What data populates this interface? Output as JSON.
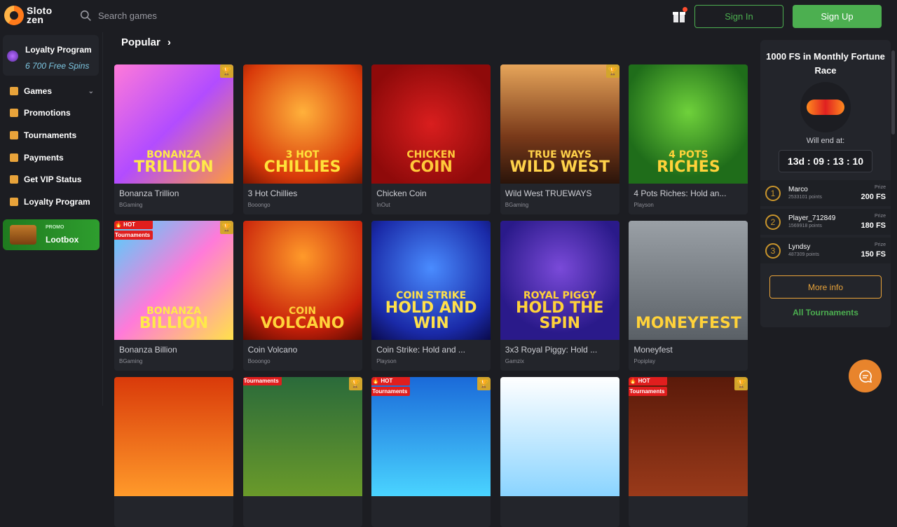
{
  "brand": {
    "name_line1": "Sloto",
    "name_line2": "zen"
  },
  "header": {
    "search_placeholder": "Search games",
    "signin_label": "Sign In",
    "signup_label": "Sign Up",
    "colors": {
      "accent_green": "#4caf50",
      "accent_orange": "#e8a33a",
      "bg": "#1c1d22"
    }
  },
  "sidebar": {
    "loyalty_card": {
      "title": "Loyalty Program",
      "subtitle": "6 700 Free Spins"
    },
    "items": [
      {
        "label": "Games",
        "icon": "gamepad-icon",
        "has_chevron": true
      },
      {
        "label": "Promotions",
        "icon": "gift-icon"
      },
      {
        "label": "Tournaments",
        "icon": "trophy-icon"
      },
      {
        "label": "Payments",
        "icon": "card-icon"
      },
      {
        "label": "Get VIP Status",
        "icon": "star-icon"
      },
      {
        "label": "Loyalty Program",
        "icon": "diamond-icon"
      }
    ],
    "lootbox": {
      "promo": "PROMO",
      "label": "Lootbox"
    }
  },
  "main": {
    "section_title": "Popular",
    "games": [
      {
        "name": "Bonanza Trillion",
        "provider": "BGaming",
        "trophy": true,
        "art_top": "BONANZA",
        "art_bottom": "TRILLION",
        "bg": "linear-gradient(135deg,#ff7ad9,#b24cff 50%,#ff9a3c)",
        "art_color": "#ffe94a"
      },
      {
        "name": "3 Hot Chillies",
        "provider": "Booongo",
        "trophy": false,
        "art_top": "3 HOT",
        "art_bottom": "CHILLIES",
        "bg": "radial-gradient(circle at 50% 40%,#ffb13b,#d93a0a 70%,#7a1400)",
        "art_color": "#ffe23a"
      },
      {
        "name": "Chicken Coin",
        "provider": "InOut",
        "trophy": false,
        "art_top": "CHICKEN",
        "art_bottom": "COIN",
        "bg": "radial-gradient(circle at 50% 50%,#d91e1e,#8f0a0a 80%)",
        "art_color": "#ffc93a"
      },
      {
        "name": "Wild West TRUEWAYS",
        "provider": "BGaming",
        "trophy": true,
        "art_top": "TRUE WAYS",
        "art_bottom": "WILD WEST",
        "bg": "linear-gradient(180deg,#e6a55a,#7a3a1a 60%,#2a140a)",
        "art_color": "#ffd24a"
      },
      {
        "name": "4 Pots Riches: Hold an...",
        "provider": "Playson",
        "trophy": false,
        "art_top": "4 POTS",
        "art_bottom": "RICHES",
        "bg": "radial-gradient(circle at 50% 40%,#6fd13b,#1f6d1a 70%)",
        "art_color": "#ffd23a"
      },
      {
        "name": "Bonanza Billion",
        "provider": "BGaming",
        "trophy": true,
        "badges": [
          "🔥 HOT",
          "Tournaments"
        ],
        "art_top": "BONANZA",
        "art_bottom": "BILLION",
        "bg": "linear-gradient(135deg,#4ad4ff,#ff7ad9 50%,#ffe14a)",
        "art_color": "#ffe94a"
      },
      {
        "name": "Coin Volcano",
        "provider": "Booongo",
        "trophy": false,
        "art_top": "COIN",
        "art_bottom": "VOLCANO",
        "bg": "radial-gradient(circle at 50% 30%,#ff9a2a,#c8200a 70%,#5a0a00)",
        "art_color": "#ffd23a"
      },
      {
        "name": "Coin Strike: Hold and ...",
        "provider": "Playson",
        "trophy": false,
        "art_top": "COIN STRIKE",
        "art_bottom": "HOLD AND WIN",
        "bg": "radial-gradient(circle at 50% 40%,#4a8cff,#1a2aa8 70%,#0a0a4a)",
        "art_color": "#ffe14a"
      },
      {
        "name": "3x3 Royal Piggy: Hold ...",
        "provider": "Gamzix",
        "trophy": false,
        "art_top": "ROYAL PIGGY",
        "art_bottom": "HOLD THE SPIN",
        "bg": "radial-gradient(circle at 50% 40%,#7a4ad9,#2a1a8a 70%)",
        "art_color": "#ffd23a"
      },
      {
        "name": "Moneyfest",
        "provider": "Popiplay",
        "trophy": false,
        "art_top": "",
        "art_bottom": "MONEYFEST",
        "bg": "linear-gradient(180deg,#9aa0a6,#5a6066)",
        "art_color": "#ffd23a"
      },
      {
        "name": "",
        "provider": "",
        "trophy": false,
        "partial": true,
        "bg": "linear-gradient(180deg,#d93a0a,#ff9a2a)"
      },
      {
        "name": "",
        "provider": "",
        "trophy": true,
        "partial": true,
        "badges": [
          "Tournaments"
        ],
        "bg": "linear-gradient(180deg,#2a6a3a,#6a9a2a)"
      },
      {
        "name": "",
        "provider": "",
        "trophy": true,
        "partial": true,
        "badges": [
          "🔥 HOT",
          "Tournaments"
        ],
        "bg": "linear-gradient(180deg,#1a6ad9,#4ad4ff)"
      },
      {
        "name": "",
        "provider": "",
        "trophy": false,
        "partial": true,
        "bg": "linear-gradient(180deg,#ffffff,#8ad4ff)"
      },
      {
        "name": "",
        "provider": "",
        "trophy": true,
        "partial": true,
        "badges": [
          "🔥 HOT",
          "Tournaments"
        ],
        "bg": "linear-gradient(180deg,#5a1a0a,#9a3a1a)"
      }
    ]
  },
  "tournament": {
    "title": "1000 FS in Monthly Fortune Race",
    "end_label": "Will end at:",
    "timer": "13d : 09 : 13 : 10",
    "prize_label": "Prize",
    "leaders": [
      {
        "rank": "1",
        "name": "Marco",
        "points": "2533101 points",
        "prize": "200 FS"
      },
      {
        "rank": "2",
        "name": "Player_712849",
        "points": "1569918 points",
        "prize": "180 FS"
      },
      {
        "rank": "3",
        "name": "Lyndsy",
        "points": "487309 points",
        "prize": "150 FS"
      }
    ],
    "more_info": "More info",
    "all_tournaments": "All Tournaments"
  }
}
